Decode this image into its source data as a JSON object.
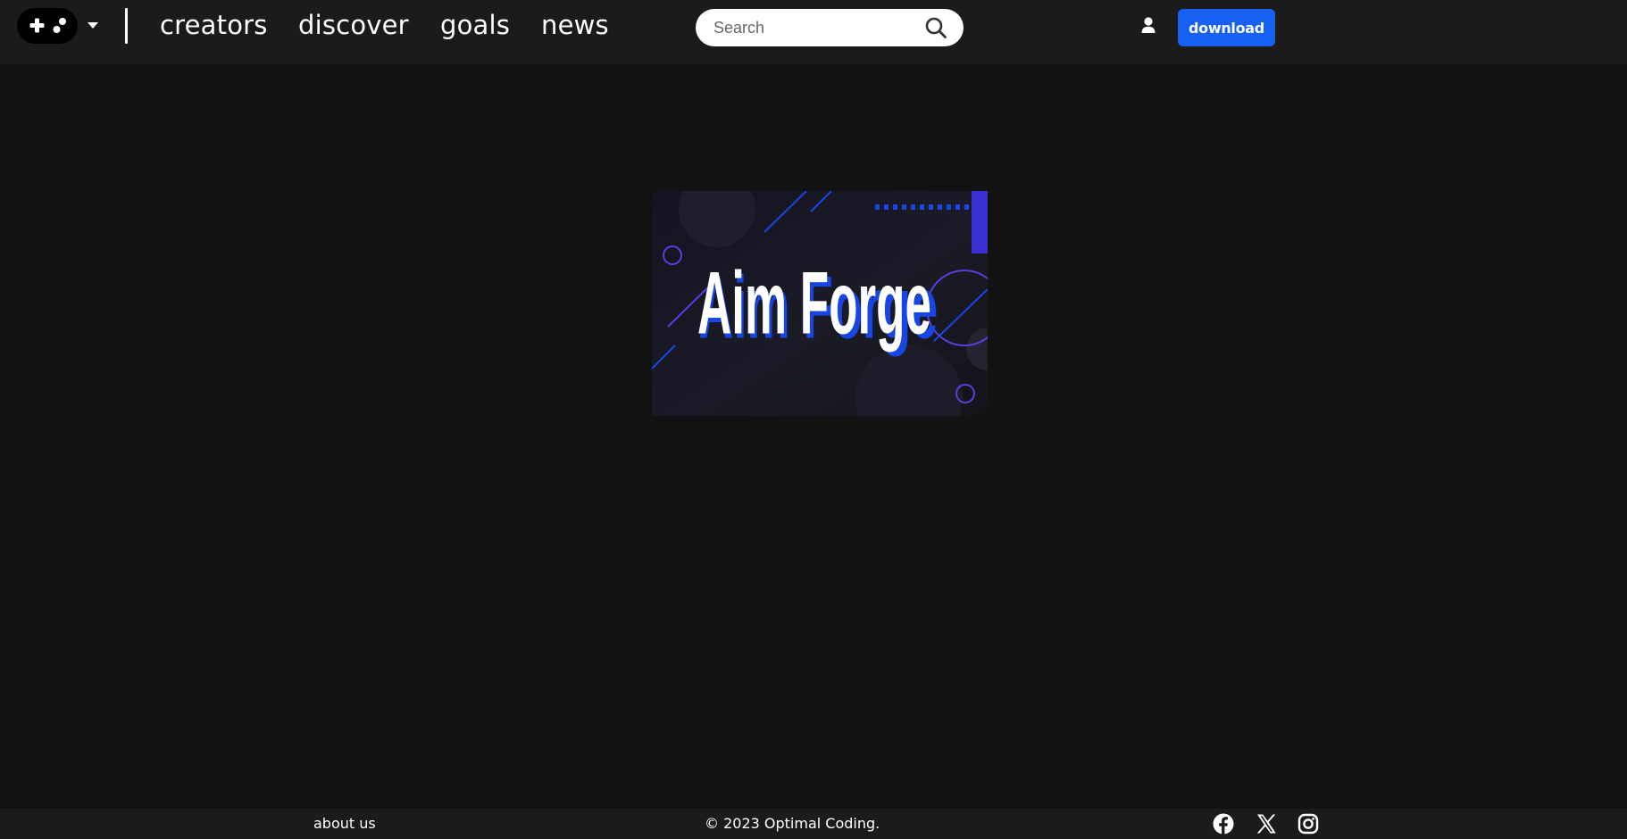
{
  "header": {
    "logo_icon": "gamepad-icon",
    "menu_caret_icon": "caret-down-icon",
    "nav": [
      {
        "label": "creators"
      },
      {
        "label": "discover"
      },
      {
        "label": "goals"
      },
      {
        "label": "news"
      }
    ],
    "search": {
      "placeholder": "Search",
      "value": "",
      "icon": "search-icon"
    },
    "user_icon": "user-icon",
    "download_label": "download"
  },
  "hero": {
    "title": "Aim Forge",
    "accent_color": "#1846e6",
    "ring_color": "#5a3de0",
    "block_color": "#3a2fd0"
  },
  "footer": {
    "about_label": "about us",
    "copyright": "© 2023 Optimal Coding.",
    "social": [
      "facebook-icon",
      "x-icon",
      "instagram-icon"
    ]
  },
  "colors": {
    "page_bg": "#121212",
    "bar_bg": "#1b1b1b",
    "brand_blue": "#1660f2"
  }
}
